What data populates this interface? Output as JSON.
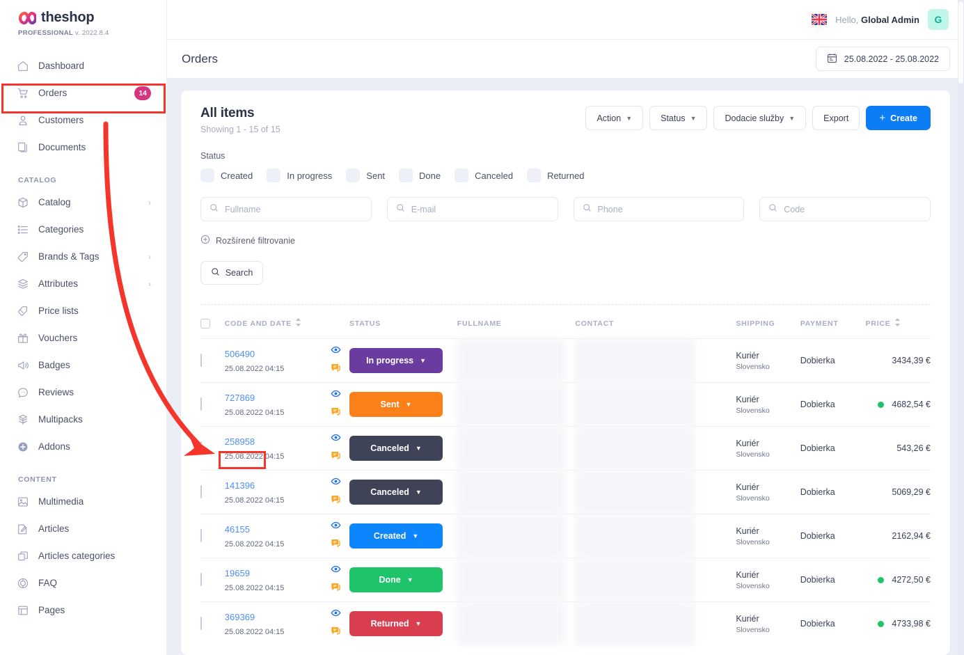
{
  "brand": {
    "name": "theshop",
    "edition": "PROFESSIONAL",
    "version": "v. 2022.8.4"
  },
  "sidebar": {
    "items": [
      {
        "label": "Dashboard",
        "icon": "home-icon",
        "badge": null,
        "chevron": false
      },
      {
        "label": "Orders",
        "icon": "cart-icon",
        "badge": "14",
        "chevron": false
      },
      {
        "label": "Customers",
        "icon": "user-icon",
        "badge": null,
        "chevron": false
      },
      {
        "label": "Documents",
        "icon": "documents-icon",
        "badge": null,
        "chevron": false
      }
    ],
    "groups": [
      {
        "title": "CATALOG",
        "items": [
          {
            "label": "Catalog",
            "icon": "box-icon",
            "chevron": true
          },
          {
            "label": "Categories",
            "icon": "list-icon",
            "chevron": false
          },
          {
            "label": "Brands & Tags",
            "icon": "tag-icon",
            "chevron": true
          },
          {
            "label": "Attributes",
            "icon": "layers-icon",
            "chevron": true
          },
          {
            "label": "Price lists",
            "icon": "pricetag-icon",
            "chevron": false
          },
          {
            "label": "Vouchers",
            "icon": "gift-icon",
            "chevron": false
          },
          {
            "label": "Badges",
            "icon": "megaphone-icon",
            "chevron": false
          },
          {
            "label": "Reviews",
            "icon": "chat-icon",
            "chevron": false
          },
          {
            "label": "Multipacks",
            "icon": "multipack-icon",
            "chevron": false
          },
          {
            "label": "Addons",
            "icon": "plus-circle-icon",
            "chevron": false
          }
        ]
      },
      {
        "title": "CONTENT",
        "items": [
          {
            "label": "Multimedia",
            "icon": "image-icon",
            "chevron": false
          },
          {
            "label": "Articles",
            "icon": "pencil-icon",
            "chevron": false
          },
          {
            "label": "Articles categories",
            "icon": "copy-icon",
            "chevron": false
          },
          {
            "label": "FAQ",
            "icon": "faq-icon",
            "chevron": false
          },
          {
            "label": "Pages",
            "icon": "page-icon",
            "chevron": false
          }
        ]
      }
    ]
  },
  "topbar": {
    "language_icon": "uk-flag-icon",
    "greeting_prefix": "Hello, ",
    "user_name": "Global Admin",
    "avatar_initial": "G"
  },
  "pagehead": {
    "title": "Orders",
    "date_range": "25.08.2022 - 25.08.2022",
    "calendar_icon": "calendar-icon"
  },
  "card": {
    "heading": "All items",
    "showing": "Showing 1 - 15 of 15",
    "toolbar": {
      "action": "Action",
      "status": "Status",
      "delivery": "Dodacie služby",
      "export": "Export",
      "create": "Create"
    },
    "status_filter": {
      "label": "Status",
      "options": [
        "Created",
        "In progress",
        "Sent",
        "Done",
        "Canceled",
        "Returned"
      ]
    },
    "filters": [
      {
        "placeholder": "Fullname",
        "value": "",
        "name": "fullname-input"
      },
      {
        "placeholder": "E-mail",
        "value": "",
        "name": "email-input"
      },
      {
        "placeholder": "Phone",
        "value": "",
        "name": "phone-input"
      },
      {
        "placeholder": "Code",
        "value": "",
        "name": "code-input"
      }
    ],
    "advanced_filter": "Rozšírené filtrovanie",
    "search_button": "Search"
  },
  "table": {
    "columns": [
      {
        "label": "CODE AND DATE",
        "sortable": true
      },
      {
        "label": "STATUS",
        "sortable": false
      },
      {
        "label": "FULLNAME",
        "sortable": false
      },
      {
        "label": "CONTACT",
        "sortable": false
      },
      {
        "label": "SHIPPING",
        "sortable": false
      },
      {
        "label": "PAYMENT",
        "sortable": false
      },
      {
        "label": "PRICE",
        "sortable": true
      }
    ],
    "rows": [
      {
        "code": "506490",
        "date": "25.08.2022 04:15",
        "status": "In progress",
        "status_color": "#6b3ca0",
        "fullname": "",
        "contact": "",
        "shipping": "Kuriér",
        "shipping_sub": "Slovensko",
        "payment": "Dobierka",
        "paid": false,
        "price": "3434,39 €"
      },
      {
        "code": "727869",
        "date": "25.08.2022 04:15",
        "status": "Sent",
        "status_color": "#fb8019",
        "fullname": "",
        "contact": "",
        "shipping": "Kuriér",
        "shipping_sub": "Slovensko",
        "payment": "Dobierka",
        "paid": true,
        "price": "4682,54 €"
      },
      {
        "code": "258958",
        "date": "25.08.2022 04:15",
        "status": "Canceled",
        "status_color": "#3e4357",
        "fullname": "",
        "contact": "",
        "shipping": "Kuriér",
        "shipping_sub": "Slovensko",
        "payment": "Dobierka",
        "paid": false,
        "price": "543,26 €"
      },
      {
        "code": "141396",
        "date": "25.08.2022 04:15",
        "status": "Canceled",
        "status_color": "#3e4357",
        "fullname": "",
        "contact": "",
        "shipping": "Kuriér",
        "shipping_sub": "Slovensko",
        "payment": "Dobierka",
        "paid": false,
        "price": "5069,29 €"
      },
      {
        "code": "46155",
        "date": "25.08.2022 04:15",
        "status": "Created",
        "status_color": "#0d85fc",
        "fullname": "",
        "contact": "",
        "shipping": "Kuriér",
        "shipping_sub": "Slovensko",
        "payment": "Dobierka",
        "paid": false,
        "price": "2162,94 €"
      },
      {
        "code": "19659",
        "date": "25.08.2022 04:15",
        "status": "Done",
        "status_color": "#1fc46a",
        "fullname": "",
        "contact": "",
        "shipping": "Kuriér",
        "shipping_sub": "Slovensko",
        "payment": "Dobierka",
        "paid": true,
        "price": "4272,50 €"
      },
      {
        "code": "369369",
        "date": "25.08.2022 04:15",
        "status": "Returned",
        "status_color": "#d93e4f",
        "fullname": "",
        "contact": "",
        "shipping": "Kuriér",
        "shipping_sub": "Slovensko",
        "payment": "Dobierka",
        "paid": true,
        "price": "4733,98 €"
      }
    ]
  },
  "annotations": {
    "highlight_color": "#f5352b",
    "boxes": [
      "sidebar-orders-item",
      "order-code-258958"
    ],
    "arrow": "curved-arrow-from-orders-to-order-code"
  },
  "colors": {
    "accent_blue": "#0d7df5",
    "badge_pink": "#d6357f",
    "link_blue": "#4f8ff7",
    "paid_green": "#1fc46a",
    "eye_icon": "#1e6ff0",
    "note_icon": "#f9a826"
  }
}
